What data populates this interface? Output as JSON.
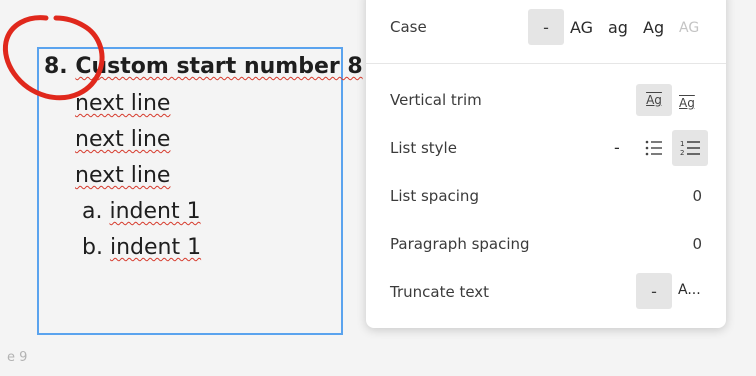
{
  "canvas": {
    "heading": "8. Custom start number 8",
    "heading_num": "8.",
    "heading_text": "Custom start number 8",
    "lines": [
      "next line",
      "next line",
      "next line"
    ],
    "sub_items": [
      {
        "marker": "a.",
        "text": "indent 1"
      },
      {
        "marker": "b.",
        "text": "indent 1"
      }
    ],
    "page_label": "e 9"
  },
  "panel": {
    "case": {
      "label": "Case",
      "options": [
        "-",
        "AG",
        "ag",
        "Ag",
        "AG"
      ],
      "selected": "-"
    },
    "vertical_trim": {
      "label": "Vertical trim",
      "options": [
        "Ag",
        "Ag"
      ]
    },
    "list_style": {
      "label": "List style",
      "none": "-",
      "numbered_glyph": "1\n2"
    },
    "list_spacing": {
      "label": "List spacing",
      "value": "0"
    },
    "paragraph_spacing": {
      "label": "Paragraph spacing",
      "value": "0"
    },
    "truncate_text": {
      "label": "Truncate text",
      "options": [
        "-",
        "A..."
      ]
    }
  }
}
